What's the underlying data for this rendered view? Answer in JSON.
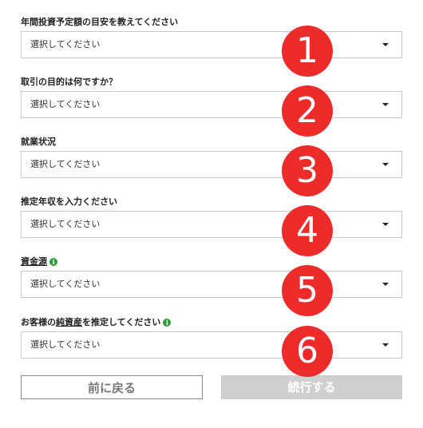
{
  "questions": [
    {
      "label": "年間投資予定額の目安を教えてください",
      "value": "選択してください",
      "badge": "1"
    },
    {
      "label": "取引の目的は何ですか？",
      "value": "選択してください",
      "badge": "2"
    },
    {
      "label": "就業状況",
      "value": "選択してください",
      "badge": "3"
    },
    {
      "label": "推定年収を入力ください",
      "value": "選択してください",
      "badge": "4"
    },
    {
      "label": "資金源",
      "value": "選択してください",
      "badge": "5",
      "info_icon": "info-icon"
    },
    {
      "label_parts": [
        "お客様の",
        "純資産",
        "を推定してください"
      ],
      "value": "選択してください",
      "badge": "6",
      "info_icon": "info-icon"
    }
  ],
  "buttons": {
    "back": "前に戻る",
    "next": "続行する"
  },
  "colors": {
    "badge": "#ee2b2b",
    "info": "#2e9a3a",
    "next_disabled": "#cfcfcf"
  }
}
